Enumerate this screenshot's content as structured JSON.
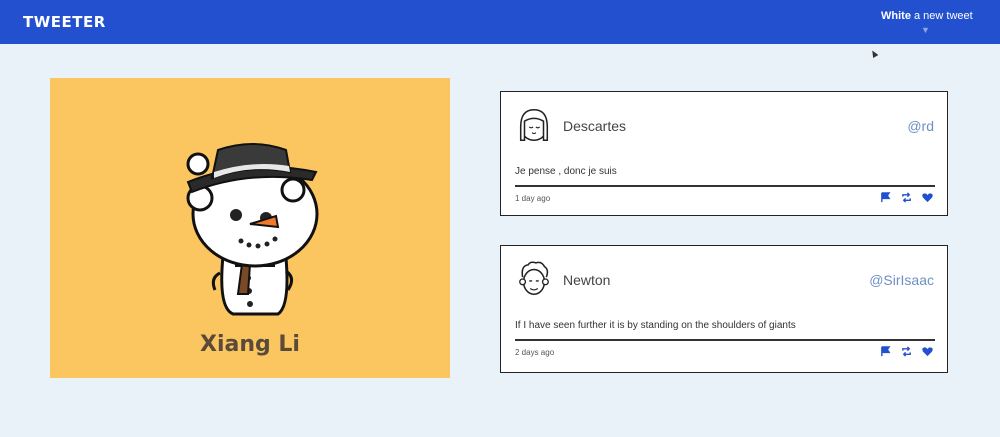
{
  "header": {
    "brand": "TWEETER",
    "compose_bold": "White",
    "compose_rest": " a new tweet",
    "accent_color": "#2350cf"
  },
  "profile": {
    "name": "Xiang Li",
    "background_color": "#fbc560"
  },
  "tweets": [
    {
      "name": "Descartes",
      "handle": "@rd",
      "text": "Je pense , donc je suis",
      "time": "1 day ago",
      "actions": [
        "flag-icon",
        "retweet-icon",
        "heart-icon"
      ]
    },
    {
      "name": "Newton",
      "handle": "@SirIsaac",
      "text": "If I have seen further it is by standing on the shoulders of giants",
      "time": "2 days ago",
      "actions": [
        "flag-icon",
        "retweet-icon",
        "heart-icon"
      ]
    }
  ]
}
